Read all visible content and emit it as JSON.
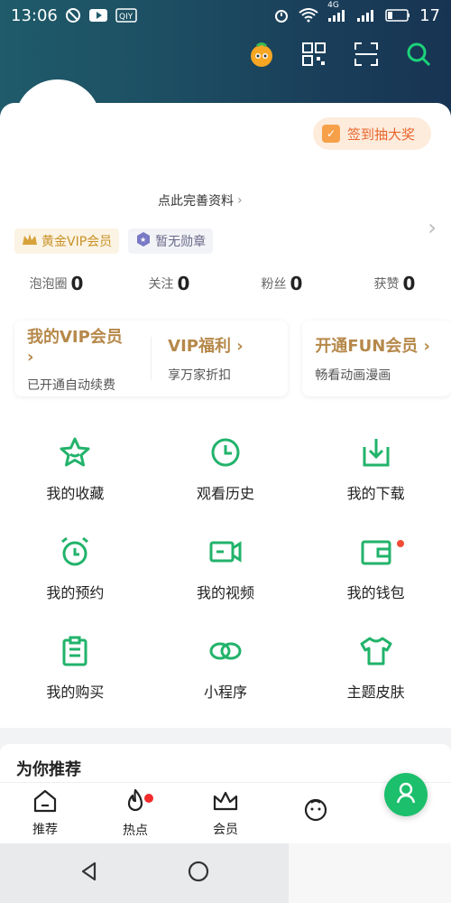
{
  "status": {
    "time": "13:06",
    "net": "4G",
    "battery": "17"
  },
  "header": {
    "icons": [
      "mascot-avatar-icon",
      "qr-code-icon",
      "scan-icon",
      "search-icon"
    ]
  },
  "profile": {
    "signin_label": "签到抽大奖",
    "complete_label": "点此完善资料",
    "badges": [
      {
        "label": "黄金VIP会员"
      },
      {
        "label": "暂无勋章"
      }
    ],
    "stats": [
      {
        "label": "泡泡圈",
        "value": "0"
      },
      {
        "label": "关注",
        "value": "0"
      },
      {
        "label": "粉丝",
        "value": "0"
      },
      {
        "label": "获赞",
        "value": "0"
      }
    ],
    "vip_cards": [
      {
        "title": "我的VIP会员 ›",
        "sub": "已开通自动续费"
      },
      {
        "title": "VIP福利 ›",
        "sub": "享万家折扣"
      },
      {
        "title": "开通FUN会员 ›",
        "sub": "畅看动画漫画"
      }
    ]
  },
  "grid": {
    "items": [
      {
        "label": "我的收藏",
        "icon": "star-icon"
      },
      {
        "label": "观看历史",
        "icon": "clock-icon"
      },
      {
        "label": "我的下载",
        "icon": "download-icon"
      },
      {
        "label": "我的预约",
        "icon": "alarm-icon"
      },
      {
        "label": "我的视频",
        "icon": "video-icon"
      },
      {
        "label": "我的钱包",
        "icon": "wallet-icon"
      },
      {
        "label": "我的购买",
        "icon": "clipboard-icon"
      },
      {
        "label": "小程序",
        "icon": "link-icon"
      },
      {
        "label": "主题皮肤",
        "icon": "tshirt-icon"
      }
    ]
  },
  "recommend": {
    "title": "为你推荐"
  },
  "tabs": [
    {
      "label": "推荐",
      "icon": "home-icon"
    },
    {
      "label": "热点",
      "icon": "flame-icon"
    },
    {
      "label": "会员",
      "icon": "crown-icon"
    },
    {
      "label": "",
      "icon": "face-icon"
    },
    {
      "label": "",
      "icon": "profile-icon"
    }
  ],
  "colors": {
    "accent": "#22b36b",
    "vip_gold": "#b6884a",
    "signin_bg": "#fdecdc",
    "signin_text": "#e9662e"
  }
}
